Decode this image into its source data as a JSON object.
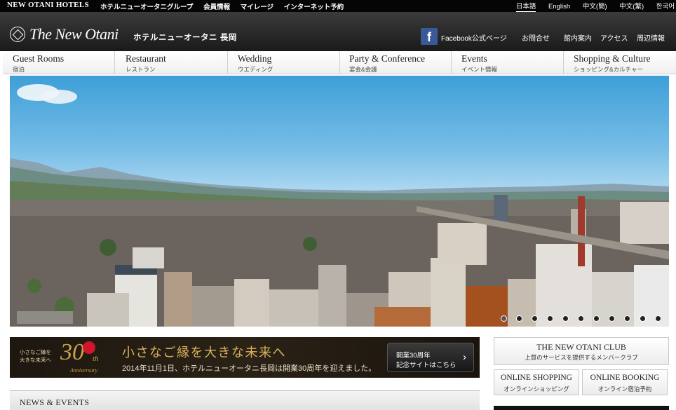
{
  "topbar": {
    "brand": "NEW OTANI HOTELS",
    "links": [
      "ホテルニューオータニグループ",
      "会員情報",
      "マイレージ",
      "インターネット予約"
    ],
    "languages": [
      "日本語",
      "English",
      "中文(簡)",
      "中文(繁)",
      "한국어"
    ],
    "active_language": "日本語"
  },
  "header": {
    "logo_text": "The New Otani",
    "hotel_name": "ホテルニューオータニ 長岡",
    "facebook_label": "Facebook公式ページ",
    "links": [
      "お問合せ",
      "館内案内",
      "アクセス",
      "周辺情報"
    ]
  },
  "nav": [
    {
      "en": "Guest Rooms",
      "jp": "宿泊"
    },
    {
      "en": "Restaurant",
      "jp": "レストラン"
    },
    {
      "en": "Wedding",
      "jp": "ウエディング"
    },
    {
      "en": "Party & Conference",
      "jp": "宴会&会議"
    },
    {
      "en": "Events",
      "jp": "イベント情報"
    },
    {
      "en": "Shopping & Culture",
      "jp": "ショッピング&カルチャー"
    }
  ],
  "slider": {
    "dot_count": 11,
    "active_dot": 0
  },
  "banner": {
    "small_lines": [
      "小さなご縁を",
      "大きな未来へ"
    ],
    "number": "30",
    "suffix": "th",
    "anniversary": "Anniversary",
    "title": "小さなご縁を大きな未来へ",
    "description": "2014年11月1日、ホテルニューオータニ長岡は開業30周年を迎えました。",
    "button_line1": "開業30周年",
    "button_line2": "記念サイトはこちら"
  },
  "news": {
    "title": "NEWS & EVENTS"
  },
  "side": {
    "club_title": "THE NEW OTANI CLUB",
    "club_sub": "上質のサービスを提供するメンバークラブ",
    "shopping_title": "ONLINE SHOPPING",
    "shopping_sub": "オンラインショッピング",
    "booking_title": "ONLINE BOOKING",
    "booking_sub": "オンライン宿泊予約"
  }
}
